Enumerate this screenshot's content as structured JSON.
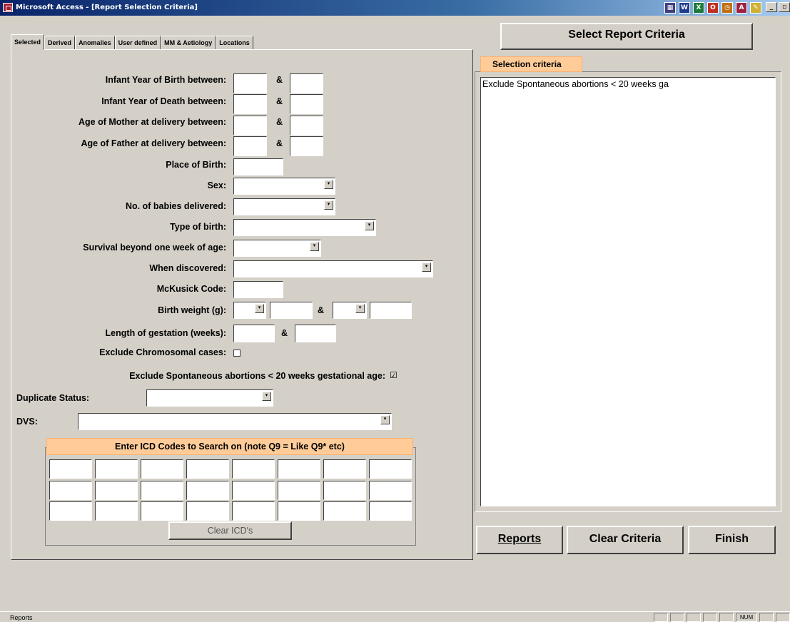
{
  "window": {
    "title": "Microsoft Access - [Report Selection Criteria]"
  },
  "toolbar_icons": [
    "grid-icon",
    "word-icon",
    "excel-icon",
    "outlook-icon",
    "schedule-icon",
    "access-icon",
    "notepad-icon"
  ],
  "win_buttons": {
    "minimize": "_",
    "restore": "▫",
    "close": "×"
  },
  "tabs": [
    "Selected",
    "Derived",
    "Anomalies",
    "User defined",
    "MM & Aetiology",
    "Locations"
  ],
  "active_tab": "Selected",
  "form": {
    "infant_birth_label": "Infant Year of Birth between:",
    "infant_death_label": "Infant Year of Death between:",
    "mother_age_label": "Age of Mother at delivery between:",
    "father_age_label": "Age of Father at delivery between:",
    "amp": "&",
    "place_of_birth_label": "Place of Birth:",
    "sex_label": "Sex:",
    "babies_label": "No. of babies delivered:",
    "type_birth_label": "Type of birth:",
    "survival_label": "Survival beyond one week of age:",
    "when_label": "When discovered:",
    "mckusick_label": "McKusick Code:",
    "birth_weight_label": "Birth weight (g):",
    "gestation_label": "Length of gestation (weeks):",
    "exclude_chrom_label": "Exclude Chromosomal cases:",
    "exclude_chrom_checked": "",
    "exclude_spont_label": "Exclude Spontaneous abortions < 20 weeks gestational age:",
    "exclude_spont_checked": "☑",
    "duplicate_label": "Duplicate Status:",
    "dvs_label": "DVS:",
    "combo_arrow": "▾"
  },
  "icd": {
    "header": "Enter ICD Codes to Search on (note Q9 = Like Q9* etc)",
    "rows": 3,
    "cols": 8,
    "clear_label": "Clear ICD's"
  },
  "right": {
    "header_button": "Select Report Criteria",
    "selection_tab": "Selection criteria",
    "selection_text": "Exclude Spontaneous abortions < 20 weeks ga"
  },
  "buttons": {
    "reports": "Reports",
    "clear_criteria": "Clear Criteria",
    "finish": "Finish"
  },
  "status": {
    "text": "Reports",
    "num": "NUM"
  }
}
